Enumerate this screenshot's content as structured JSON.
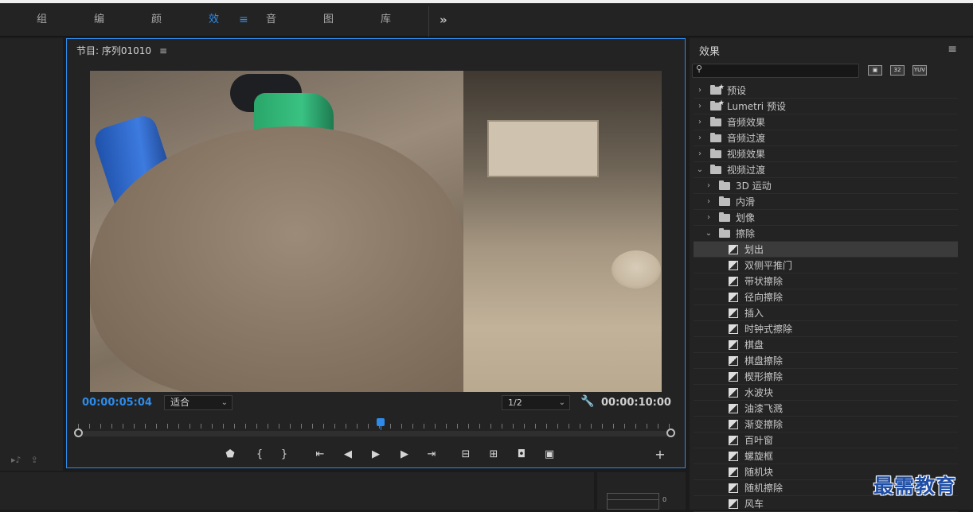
{
  "workspace": {
    "tabs": [
      {
        "label": "组件",
        "active": false
      },
      {
        "label": "编辑",
        "active": false
      },
      {
        "label": "颜色",
        "active": false
      },
      {
        "label": "效果",
        "active": true
      },
      {
        "label": "音频",
        "active": false
      },
      {
        "label": "图形",
        "active": false
      },
      {
        "label": "库",
        "active": false
      }
    ],
    "menu_glyph": "≡",
    "more_glyph": "»"
  },
  "program": {
    "title": "节目: 序列01010",
    "menu_glyph": "≡",
    "current_time": "00:00:05:04",
    "fit_select": "适合",
    "resolution_select": "1/2",
    "duration": "00:00:10:00",
    "transport": [
      "add-marker",
      "mark-in",
      "mark-out",
      "go-to-in",
      "step-back",
      "play",
      "step-forward",
      "go-to-out",
      "lift",
      "extract",
      "export-frame",
      "compare",
      "add"
    ],
    "transport_glyphs": {
      "marker": "⬟",
      "mark_in": "{",
      "mark_out": "}",
      "go_in": "⇤",
      "step_back": "◀",
      "play": "▶",
      "step_fwd": "▶",
      "go_out": "⇥",
      "lift": "⊟",
      "extract": "⊞",
      "camera": "◘",
      "compare": "▣",
      "add": "+"
    },
    "playhead_fraction": 0.51
  },
  "effects": {
    "title": "效果",
    "menu_glyph": "≡",
    "search_value": "",
    "badges": [
      "32",
      "YUV"
    ],
    "items": [
      {
        "label": "预设",
        "depth": 0,
        "expanded": false,
        "type": "preset-folder"
      },
      {
        "label": "Lumetri 预设",
        "depth": 0,
        "expanded": false,
        "type": "preset-folder"
      },
      {
        "label": "音频效果",
        "depth": 0,
        "expanded": false,
        "type": "folder"
      },
      {
        "label": "音频过渡",
        "depth": 0,
        "expanded": false,
        "type": "folder"
      },
      {
        "label": "视频效果",
        "depth": 0,
        "expanded": false,
        "type": "folder"
      },
      {
        "label": "视频过渡",
        "depth": 0,
        "expanded": true,
        "type": "folder"
      },
      {
        "label": "3D 运动",
        "depth": 1,
        "expanded": false,
        "type": "folder"
      },
      {
        "label": "内滑",
        "depth": 1,
        "expanded": false,
        "type": "folder"
      },
      {
        "label": "划像",
        "depth": 1,
        "expanded": false,
        "type": "folder"
      },
      {
        "label": "擦除",
        "depth": 1,
        "expanded": true,
        "type": "folder"
      },
      {
        "label": "划出",
        "depth": 2,
        "type": "effect",
        "selected": true
      },
      {
        "label": "双侧平推门",
        "depth": 2,
        "type": "effect"
      },
      {
        "label": "带状擦除",
        "depth": 2,
        "type": "effect"
      },
      {
        "label": "径向擦除",
        "depth": 2,
        "type": "effect"
      },
      {
        "label": "插入",
        "depth": 2,
        "type": "effect"
      },
      {
        "label": "时钟式擦除",
        "depth": 2,
        "type": "effect"
      },
      {
        "label": "棋盘",
        "depth": 2,
        "type": "effect"
      },
      {
        "label": "棋盘擦除",
        "depth": 2,
        "type": "effect"
      },
      {
        "label": "楔形擦除",
        "depth": 2,
        "type": "effect"
      },
      {
        "label": "水波块",
        "depth": 2,
        "type": "effect"
      },
      {
        "label": "油漆飞溅",
        "depth": 2,
        "type": "effect"
      },
      {
        "label": "渐变擦除",
        "depth": 2,
        "type": "effect"
      },
      {
        "label": "百叶窗",
        "depth": 2,
        "type": "effect"
      },
      {
        "label": "螺旋框",
        "depth": 2,
        "type": "effect"
      },
      {
        "label": "随机块",
        "depth": 2,
        "type": "effect"
      },
      {
        "label": "随机擦除",
        "depth": 2,
        "type": "effect"
      },
      {
        "label": "风车",
        "depth": 2,
        "type": "effect"
      }
    ]
  },
  "audio_meter": {
    "zero_label": "0"
  },
  "watermark": "最需教育",
  "colors": {
    "accent": "#2d8ceb",
    "panel": "#232323",
    "background": "#1b1b1b"
  }
}
